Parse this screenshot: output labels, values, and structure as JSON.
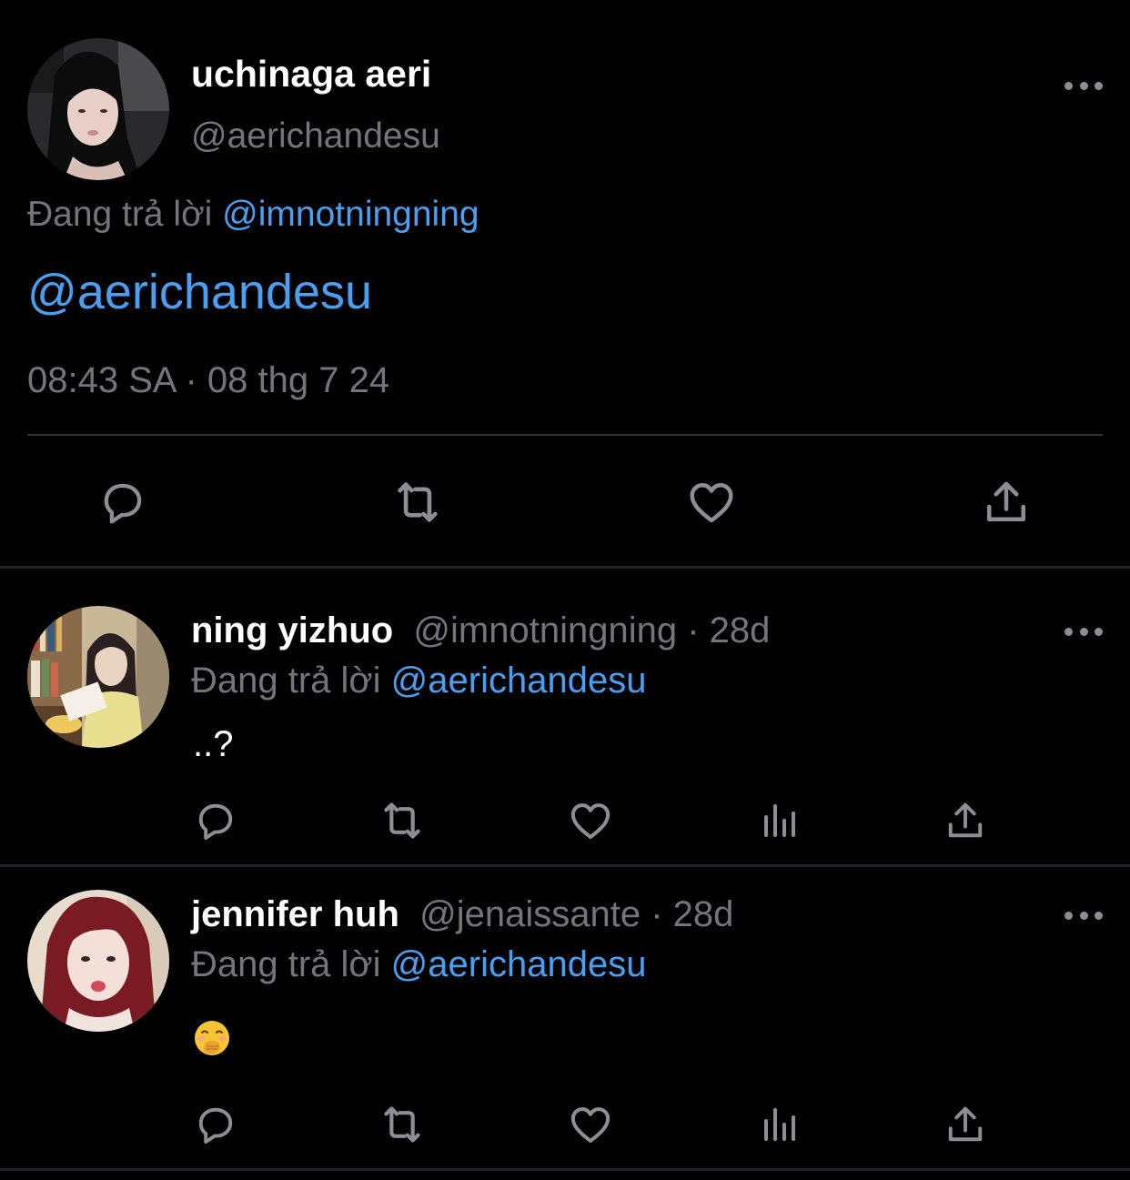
{
  "main_tweet": {
    "name": "uchinaga aeri",
    "handle": "@aerichandesu",
    "replying_prefix": "Đang trả lời",
    "replying_to": "@imnotningning",
    "body": "@aerichandesu",
    "timestamp": "08:43 SA · 08 thg 7 24",
    "actions": [
      "reply-icon",
      "retweet-icon",
      "like-icon",
      "share-icon"
    ]
  },
  "replies": [
    {
      "name": "ning yizhuo",
      "handle": "@imnotningning · 28d",
      "replying_prefix": "Đang trả lời",
      "replying_to": "@aerichandesu",
      "text": "..?",
      "actions": [
        "reply-icon",
        "retweet-icon",
        "like-icon",
        "views-icon",
        "share-icon"
      ]
    },
    {
      "name": "jennifer huh",
      "handle": "@jenaissante · 28d",
      "replying_prefix": "Đang trả lời",
      "replying_to": "@aerichandesu",
      "emoji": "hand-over-mouth-emoji",
      "actions": [
        "reply-icon",
        "retweet-icon",
        "like-icon",
        "views-icon",
        "share-icon"
      ]
    }
  ],
  "colors": {
    "background": "#000000",
    "text_primary": "#ffffff",
    "text_secondary": "#71767b",
    "link": "#4a9ff0",
    "divider": "#2f3336"
  }
}
